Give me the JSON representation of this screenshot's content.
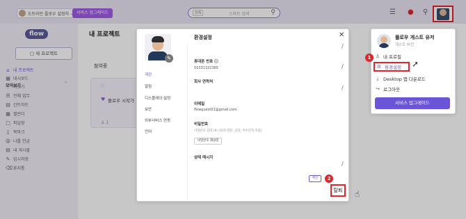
{
  "topbar": {
    "user_label": "도트라인 플로우 설정허 →",
    "upgrade_label": "서비스 업그레이드",
    "search_tag": "전체",
    "search_placeholder": "스마트 검색"
  },
  "sidebar": {
    "logo_text": "flow",
    "new_project_label": "새 프로젝트",
    "items": [
      {
        "label": "내 프로젝트",
        "icon": "home-icon",
        "active": true
      },
      {
        "label": "대시보드",
        "icon": "dashboard-icon",
        "active": false
      },
      {
        "label": "더보기",
        "icon": "more-icon",
        "active": false
      }
    ],
    "section_title": "모아보기",
    "section_items": [
      {
        "label": "전체 업무",
        "icon": "list-icon"
      },
      {
        "label": "간트차트",
        "icon": "gantt-icon"
      },
      {
        "label": "캘린더",
        "icon": "calendar-icon"
      },
      {
        "label": "파일함",
        "icon": "file-icon"
      },
      {
        "label": "북마크",
        "icon": "bookmark-icon"
      },
      {
        "label": "나를 언급",
        "icon": "mention-icon"
      },
      {
        "label": "내 게시물",
        "icon": "post-icon"
      },
      {
        "label": "임시저장",
        "icon": "draft-icon"
      },
      {
        "label": "휴지통",
        "icon": "trash-icon"
      }
    ]
  },
  "main": {
    "title": "내 프로젝트",
    "section": "참여중",
    "card_label": "플로우 시작가",
    "card_members": "1"
  },
  "settings_modal": {
    "title": "환경설정",
    "nav": [
      "계정",
      "알림",
      "디스플레이 설정",
      "보안",
      "외부서비스 연동",
      "언어"
    ],
    "phone_label": "휴대폰 번호",
    "phone_value": "01031322365",
    "company_contact_label": "회사 연락처",
    "email_label": "이메일",
    "email_value": "flowguest01@gmail.com",
    "password_label": "비밀번호",
    "password_hint": "비밀번호 입력 (8~20자 영문, 숫자, 특수문자 조합)",
    "password_button": "비밀번호 재설정",
    "status_label": "상태 메시지",
    "save_button": "확인",
    "withdraw_button": "탈퇴"
  },
  "profile_dropdown": {
    "name": "플로우 게스트 유저",
    "subtitle": "게스트 버전",
    "items": [
      {
        "label": "내 프로필",
        "icon": "person-icon"
      },
      {
        "label": "환경설정",
        "icon": "gear-icon"
      },
      {
        "label": "Desktop 앱 다운로드",
        "icon": "download-icon"
      },
      {
        "label": "로그아웃",
        "icon": "logout-icon"
      }
    ],
    "upgrade_button": "서비스 업그레이드"
  },
  "steps": [
    "1",
    "2"
  ],
  "colors": {
    "accent": "#6f5bd0",
    "highlight": "#e4242b",
    "upgrade": "#a35bea"
  }
}
